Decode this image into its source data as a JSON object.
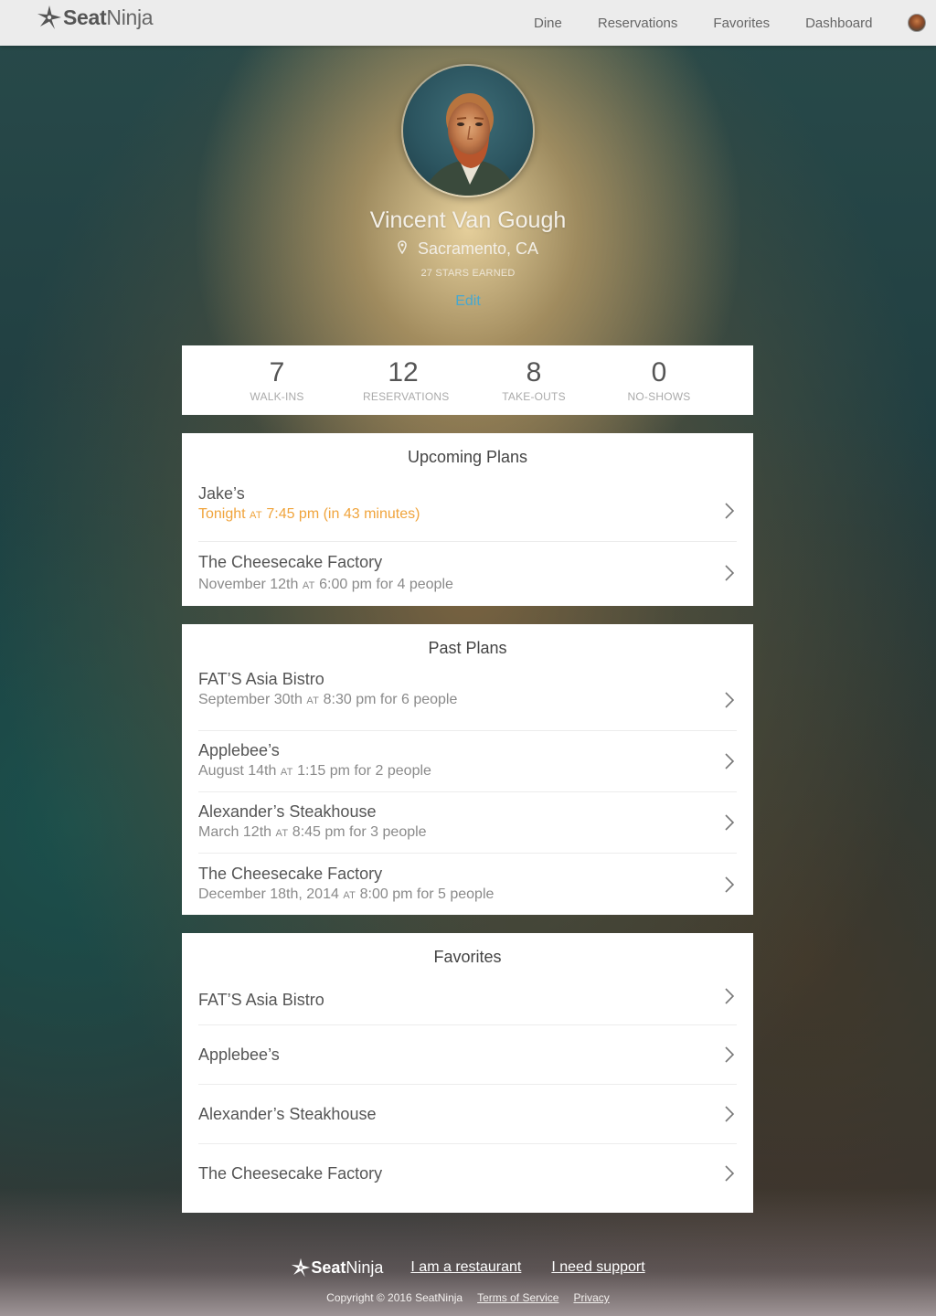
{
  "brand": {
    "name_bold": "Seat",
    "name_light": "Ninja",
    "icon": "ninja-star-icon"
  },
  "nav": {
    "links": [
      "Dine",
      "Reservations",
      "Favorites",
      "Dashboard"
    ],
    "avatar_icon": "user-avatar"
  },
  "profile": {
    "name": "Vincent Van Gough",
    "location": "Sacramento, CA",
    "location_icon": "map-pin-icon",
    "stars": "27 STARS EARNED",
    "edit_label": "Edit"
  },
  "stats": [
    {
      "value": "7",
      "label": "WALK-INS"
    },
    {
      "value": "12",
      "label": "RESERVATIONS"
    },
    {
      "value": "8",
      "label": "TAKE-OUTS"
    },
    {
      "value": "0",
      "label": "NO-SHOWS"
    }
  ],
  "upcoming": {
    "title": "Upcoming Plans",
    "items": [
      {
        "name": "Jake’s",
        "date": "Tonight",
        "at": "AT",
        "detail": "7:45 pm (in 43 minutes)"
      },
      {
        "name": "The Cheesecake Factory",
        "date": "November 12th",
        "at": "AT",
        "detail": "6:00 pm for 4 people"
      }
    ]
  },
  "past": {
    "title": "Past Plans",
    "items": [
      {
        "name": "FAT’S Asia Bistro",
        "date": "September 30th",
        "at": "AT",
        "detail": "8:30 pm for 6 people"
      },
      {
        "name": "Applebee’s",
        "date": "August 14th",
        "at": "AT",
        "detail": "1:15 pm for 2 people"
      },
      {
        "name": "Alexander’s Steakhouse",
        "date": "March 12th",
        "at": "AT",
        "detail": "8:45 pm for 3 people"
      },
      {
        "name": "The Cheesecake Factory",
        "date": "December 18th, 2014",
        "at": "AT",
        "detail": "8:00 pm for 5 people"
      }
    ]
  },
  "favorites": {
    "title": "Favorites",
    "items": [
      "FAT’S Asia Bistro",
      "Applebee’s",
      "Alexander’s Steakhouse",
      "The Cheesecake Factory"
    ]
  },
  "footer": {
    "links": [
      "I am a restaurant",
      "I need support"
    ],
    "copyright": "Copyright © 2016 SeatNinja",
    "terms": "Terms of Service",
    "privacy": "Privacy"
  },
  "colors": {
    "accent_link": "#47a8cf",
    "upcoming_highlight": "#f0a43c",
    "card_bg": "#ffffff",
    "nav_bg": "#ececec"
  }
}
